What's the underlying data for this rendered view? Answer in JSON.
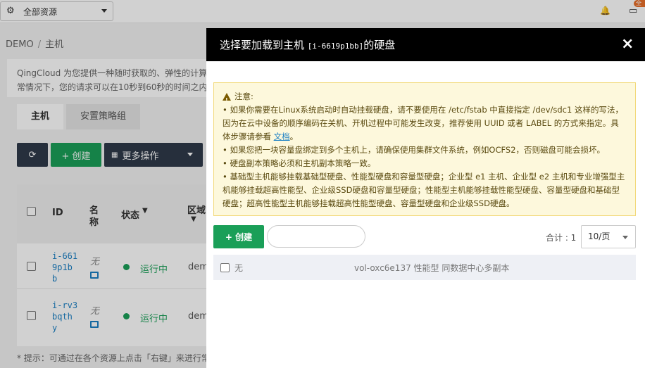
{
  "topbar": {
    "resource_selector": "全部资源",
    "badge": "全"
  },
  "breadcrumb": [
    "DEMO",
    "主机"
  ],
  "description": {
    "line1": "QingCloud 为您提供一种随时获取的、弹性的计算",
    "line2": "常情况下，您的请求可以在10秒到60秒的时间之内"
  },
  "tabs": [
    {
      "label": "主机"
    },
    {
      "label": "安置策略组"
    }
  ],
  "toolbar": {
    "create_label": "+ 创建",
    "more_label": "更多操作"
  },
  "table": {
    "headers": {
      "id": "ID",
      "name_l1": "名",
      "name_l2": "称",
      "status": "状态",
      "region_l1": "区域"
    },
    "rows": [
      {
        "id_lines": [
          "i-661",
          "9p1b",
          "b"
        ],
        "name": "无",
        "status": "运行中",
        "region": "dem"
      },
      {
        "id_lines": [
          "i-rv3",
          "bqth",
          "y"
        ],
        "name": "无",
        "status": "运行中",
        "region": "dem"
      }
    ]
  },
  "hint": "* 提示：可通过在各个资源上点击「右键」来进行常",
  "modal": {
    "title_prefix": "选择要加载到主机",
    "title_id": "[i-6619p1bb]",
    "title_suffix": "的硬盘",
    "close": "×",
    "warning": {
      "title": "注意:",
      "p1": "• 如果你需要在Linux系统启动时自动挂载硬盘，请不要使用在 /etc/fstab 中直接指定 /dev/sdc1 这样的写法， 因为在云中设备的顺序编码在关机、开机过程中可能发生改变，推荐使用 UUID 或者 LABEL 的方式来指定。具体步骤请参看 ",
      "p1_link": "文档",
      "p1_end": "。",
      "p2": "• 如果您把一块容量盘绑定到多个主机上，请确保使用集群文件系统，例如OCFS2，否则磁盘可能会损坏。",
      "p3": "• 硬盘副本策略必须和主机副本策略一致。",
      "p4": "• 基础型主机能够挂载基础型硬盘、性能型硬盘和容量型硬盘；企业型 e1 主机、企业型 e2 主机和专业增强型主机能够挂载超高性能型、企业级SSD硬盘和容量型硬盘；性能型主机能够挂载性能型硬盘、容量型硬盘和基础型硬盘；超高性能型主机能够挂载超高性能型硬盘、容量型硬盘和企业级SSD硬盘。"
    },
    "create_label": "+ 创建",
    "search_placeholder": "",
    "total": "合计 : 1",
    "page_size": "10/页",
    "rows": [
      {
        "name": "无",
        "desc": "vol-oxc6e137 性能型 同数据中心多副本"
      }
    ]
  }
}
